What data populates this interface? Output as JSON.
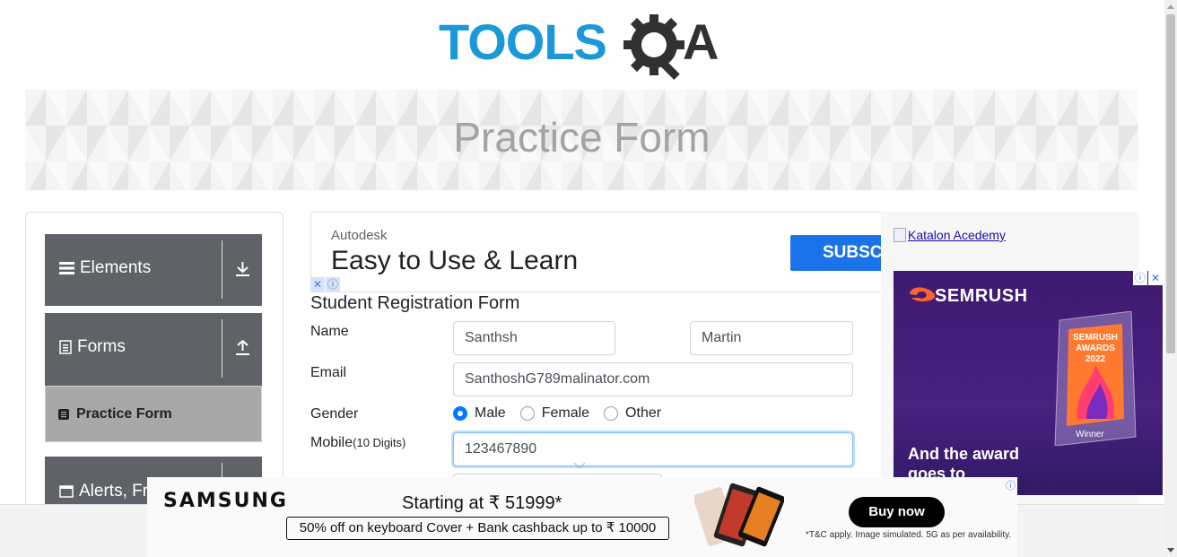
{
  "header": {
    "logo_text": "TOOLSQA",
    "page_title": "Practice Form"
  },
  "sidebar": {
    "groups": [
      {
        "label": "Elements",
        "icon": "hamburger-icon",
        "toggle": "download-arrow-icon"
      },
      {
        "label": "Forms",
        "icon": "document-icon",
        "toggle": "upload-arrow-icon"
      },
      {
        "label": "Alerts, Fr",
        "icon": "window-icon",
        "toggle": "download-arrow-icon"
      }
    ],
    "items": [
      {
        "label": "Practice Form",
        "icon": "form-icon",
        "active": true
      }
    ]
  },
  "ad_top": {
    "brand": "Autodesk",
    "headline": "Easy to Use & Learn",
    "cta": "SUBSC"
  },
  "form": {
    "title": "Student Registration Form",
    "name_label": "Name",
    "first_name": "Santhsh",
    "last_name": "Martin",
    "email_label": "Email",
    "email": "SanthoshG789malinator.com",
    "gender_label": "Gender",
    "gender_options": [
      "Male",
      "Female",
      "Other"
    ],
    "gender_selected": "Male",
    "mobile_label": "Mobile",
    "mobile_hint": "(10 Digits)",
    "mobile": "123467890"
  },
  "ad_right": {
    "katalon_alt": "Katalon Acedemy",
    "semrush_brand": "SEMRUSH",
    "semrush_award_line1": "SEMRUSH",
    "semrush_award_line2": "AWARDS",
    "semrush_award_year": "2022",
    "semrush_winner": "Winner",
    "semrush_tagline_1": "And the award",
    "semrush_tagline_2": "goes to"
  },
  "ad_bottom": {
    "brand": "SAMSUNG",
    "price_line": "Starting at ₹ 51999*",
    "offer": "50% off on keyboard Cover + Bank cashback up to ₹ 10000",
    "cta": "Buy now",
    "fine_print": "*T&C apply. Image simulated. 5G as per availability."
  },
  "colors": {
    "brand_blue": "#1b98d8",
    "sidebar_group": "#5f6367",
    "sidebar_active": "#a8a8a8",
    "radio_checked": "#007bff",
    "banner_title": "#a3a3a3"
  }
}
